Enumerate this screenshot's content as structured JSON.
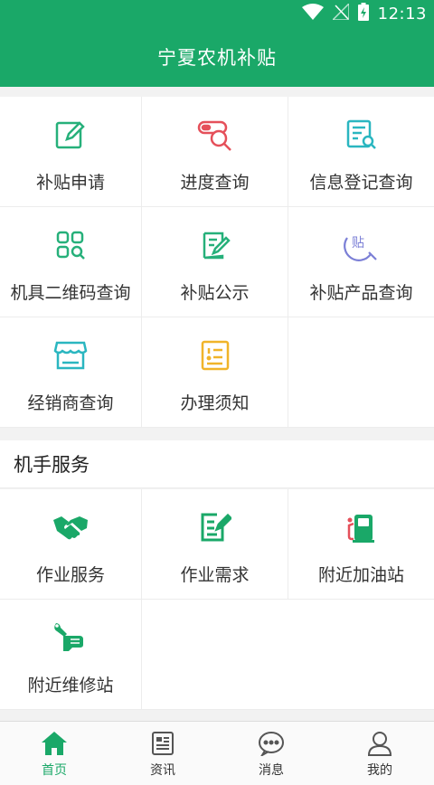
{
  "status_bar": {
    "time": "12:13"
  },
  "header": {
    "title": "宁夏农机补贴"
  },
  "main_grid": [
    {
      "label": "补贴申请",
      "icon": "edit-icon"
    },
    {
      "label": "进度查询",
      "icon": "progress-search-icon"
    },
    {
      "label": "信息登记查询",
      "icon": "form-search-icon"
    },
    {
      "label": "机具二维码查询",
      "icon": "qrcode-search-icon"
    },
    {
      "label": "补贴公示",
      "icon": "clipboard-pen-icon"
    },
    {
      "label": "补贴产品查询",
      "icon": "subsidy-product-search-icon"
    },
    {
      "label": "经销商查询",
      "icon": "store-icon"
    },
    {
      "label": "办理须知",
      "icon": "notice-icon"
    }
  ],
  "operator_section": {
    "title": "机手服务",
    "items": [
      {
        "label": "作业服务",
        "icon": "handshake-icon"
      },
      {
        "label": "作业需求",
        "icon": "demand-edit-icon"
      },
      {
        "label": "附近加油站",
        "icon": "gas-station-icon"
      },
      {
        "label": "附近维修站",
        "icon": "wrench-hand-icon"
      }
    ]
  },
  "tabs": [
    {
      "label": "首页",
      "icon": "home-icon",
      "active": true
    },
    {
      "label": "资讯",
      "icon": "news-icon",
      "active": false
    },
    {
      "label": "消息",
      "icon": "chat-bubble-icon",
      "active": false
    },
    {
      "label": "我的",
      "icon": "user-icon",
      "active": false
    }
  ],
  "colors": {
    "brand_green": "#1aa868",
    "icon_green": "#26b07a",
    "icon_red": "#e5505a",
    "icon_teal": "#2ab6c0",
    "icon_purple": "#7b7fd6",
    "icon_yellow": "#f0b429"
  }
}
